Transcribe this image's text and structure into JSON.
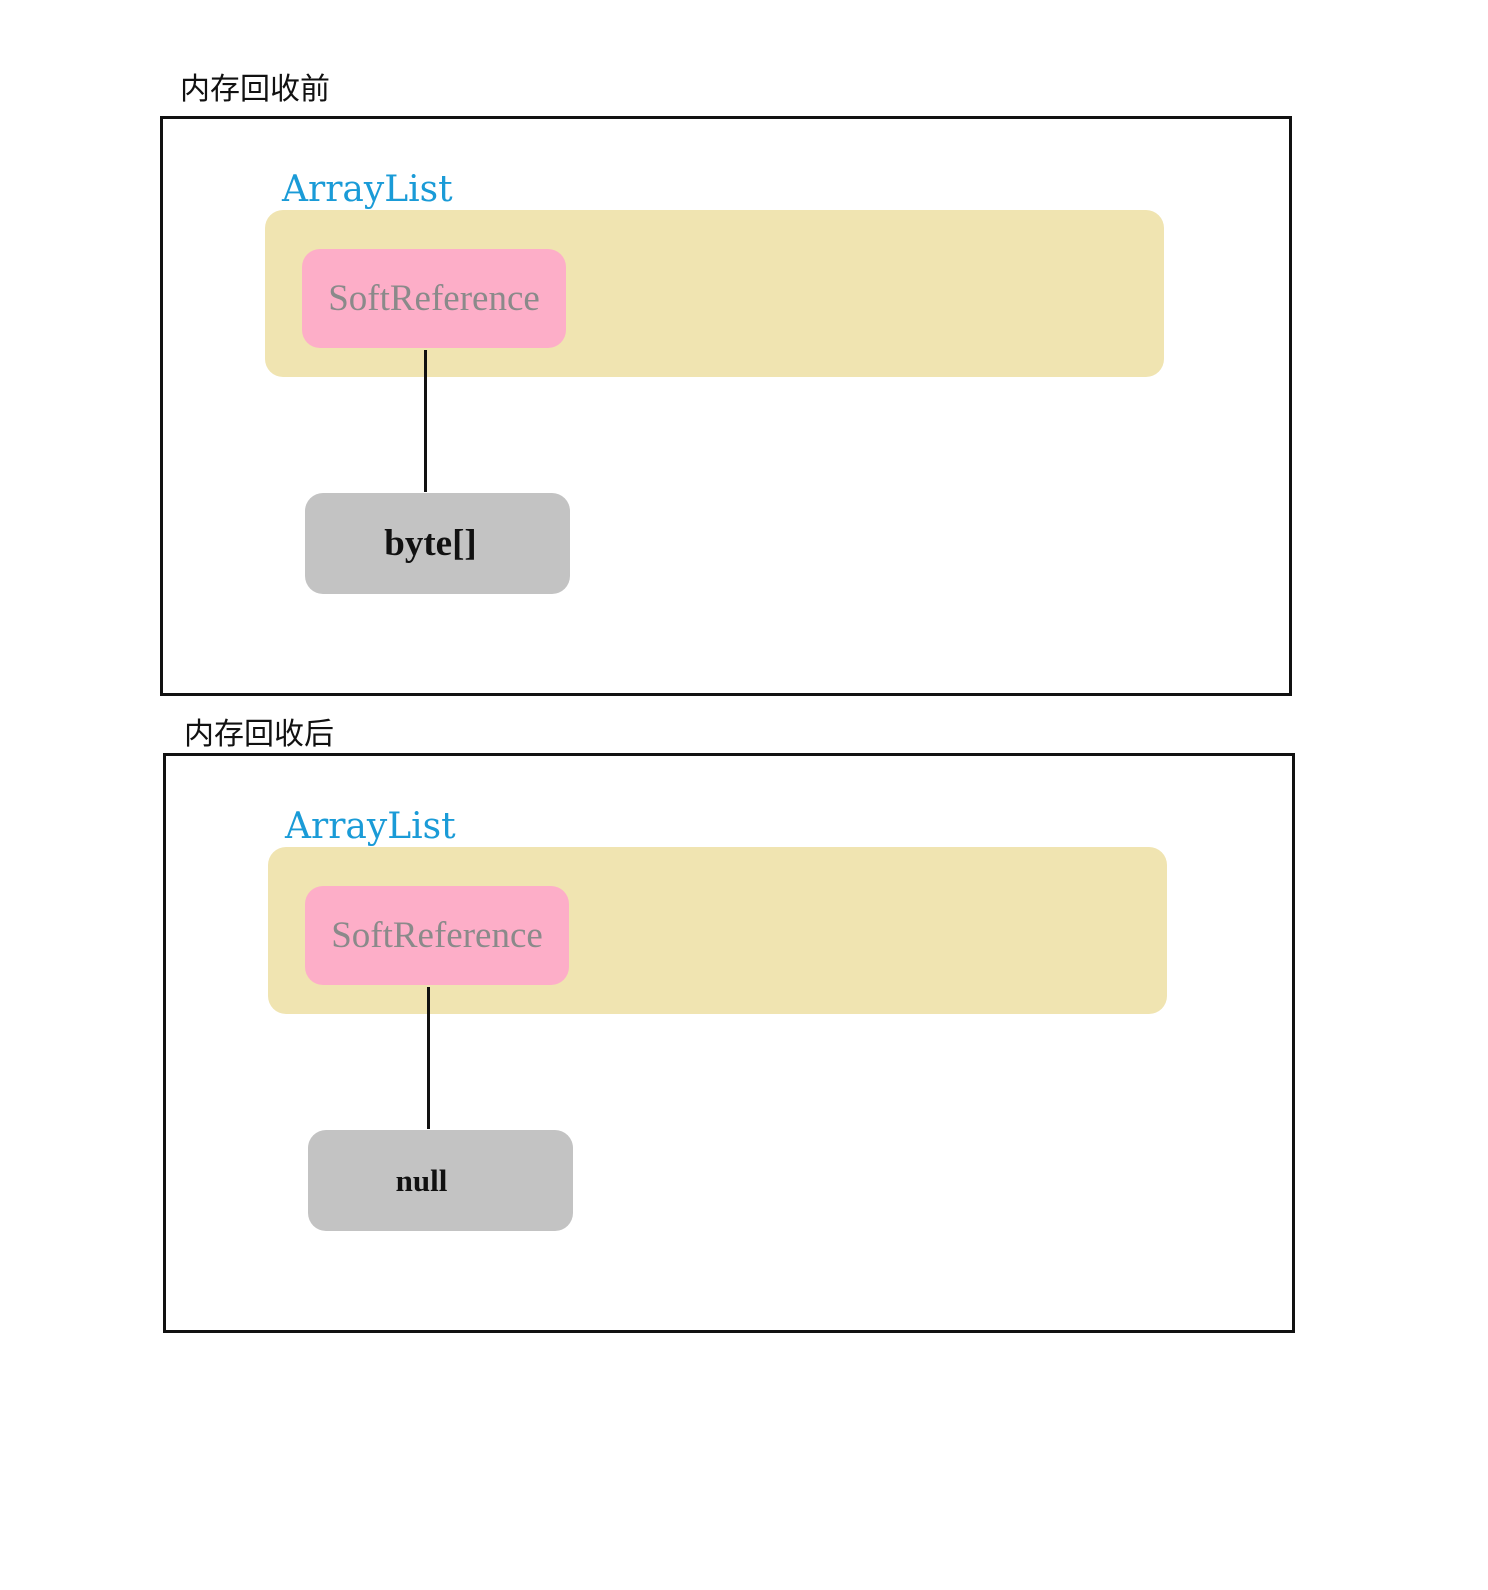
{
  "before": {
    "title": "内存回收前",
    "container_label": "ArrayList",
    "reference_label": "SoftReference",
    "target_label": "byte[]"
  },
  "after": {
    "title": "内存回收后",
    "container_label": "ArrayList",
    "reference_label": "SoftReference",
    "target_label": "null"
  },
  "colors": {
    "arraylist_text": "#1a9bd7",
    "arraylist_fill": "#f0e4b1",
    "softreference_fill": "#fdaec8",
    "softreference_text": "#8a8a8a",
    "target_fill": "#c3c3c3",
    "frame_stroke": "#111111"
  }
}
